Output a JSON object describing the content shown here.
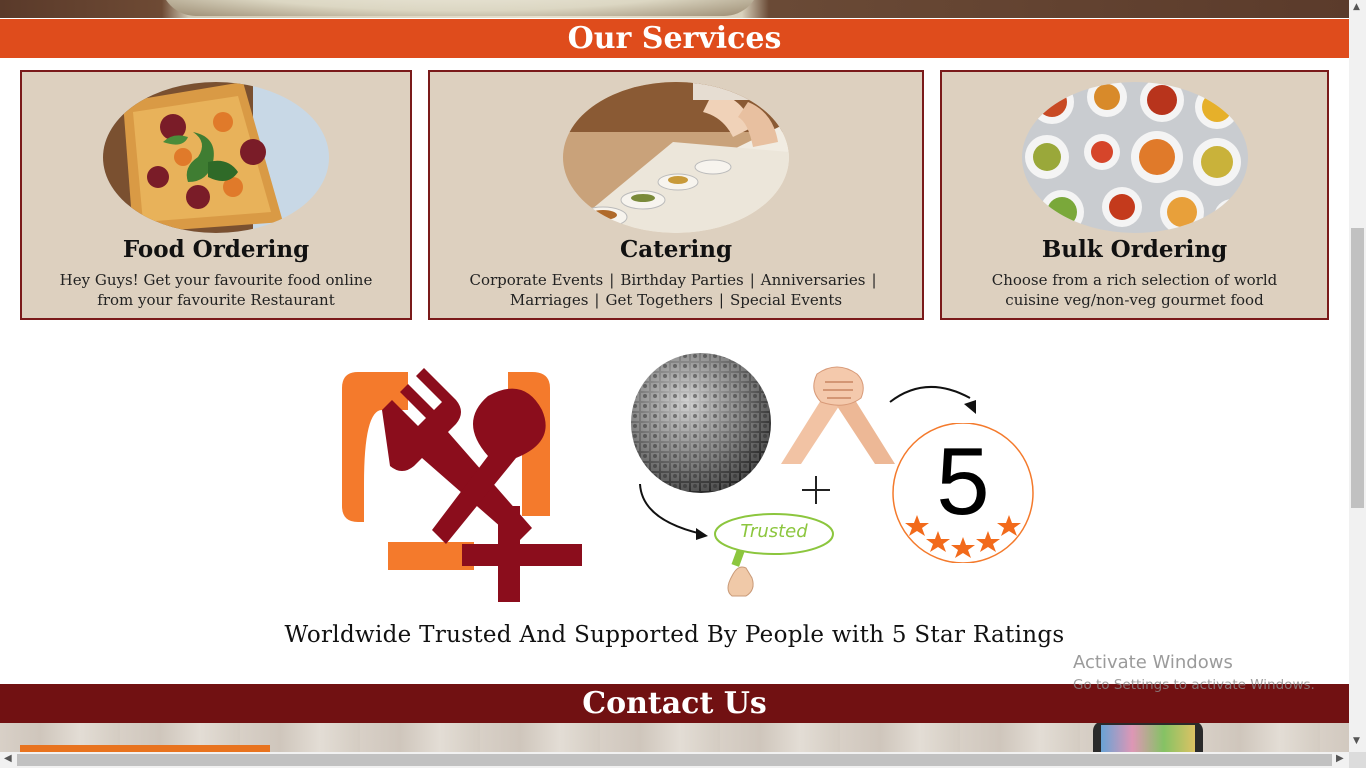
{
  "sections": {
    "services_title": "Our Services",
    "contact_title": "Contact Us"
  },
  "services": [
    {
      "title": "Food Ordering",
      "lines": [
        "Hey Guys! Get your favourite food online",
        "from your favourite Restaurant"
      ],
      "image": "pizza-photo"
    },
    {
      "title": "Catering",
      "line1_items": [
        "Corporate Events",
        "Birthday Parties",
        "Anniversaries"
      ],
      "line2_items": [
        "Marriages",
        "Get Togethers",
        "Special Events"
      ],
      "separator": "|",
      "image": "buffet-photo"
    },
    {
      "title": "Bulk Ordering",
      "lines": [
        "Choose from a rich selection of world",
        "cuisine veg/non-veg gourmet food"
      ],
      "image": "indian-dishes-photo"
    }
  ],
  "trust": {
    "logo_icon": "fork-spoon-plus-logo",
    "rating": "5",
    "badge_text": "Trusted",
    "tagline": "Worldwide Trusted And Supported By People with 5 Star Ratings"
  },
  "watermark": {
    "line1": "Activate Windows",
    "line2": "Go to Settings to activate Windows."
  },
  "colors": {
    "services_bar": "#df4c1c",
    "contact_bar": "#711112",
    "card_bg": "#ddd0bf",
    "card_border": "#7a1a1a",
    "logo_orange": "#f47a2c",
    "logo_red": "#8b0d1c"
  }
}
